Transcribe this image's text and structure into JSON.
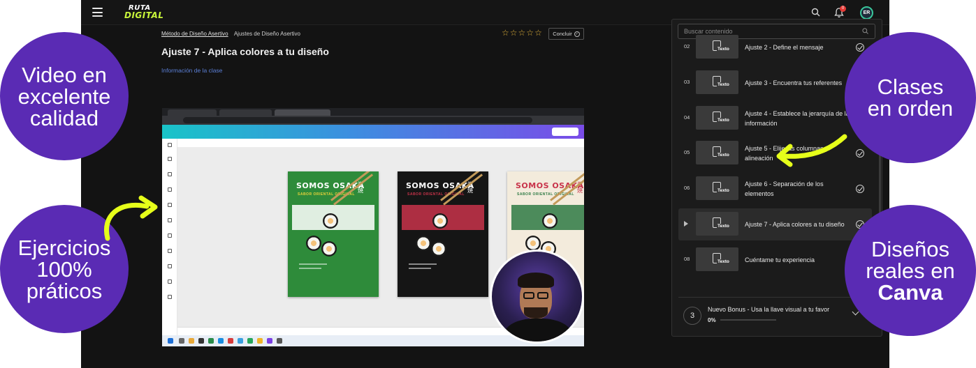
{
  "header": {
    "logo_line1": "RUTA",
    "logo_line2": "DIGITAL",
    "notification_count": "0",
    "avatar_initials": "ER"
  },
  "breadcrumb": {
    "course": "Método de Diseño Asertivo",
    "section": "Ajustes de Diseño Asertivo"
  },
  "rating": {
    "stars_filled": 0,
    "stars_total": 5
  },
  "concluir_label": "Concluir",
  "lesson_title": "Ajuste 7 - Aplica colores a tu diseño",
  "info_link": "Información de la clase",
  "sidebar": {
    "search_placeholder": "Buscar contenido",
    "thumb_label": "Texto",
    "lessons": [
      {
        "num": "02",
        "title": "Ajuste 2 - Define el mensaje",
        "completed": true,
        "active": false
      },
      {
        "num": "03",
        "title": "Ajuste 3 - Encuentra tus referentes",
        "completed": true,
        "active": false
      },
      {
        "num": "04",
        "title": "Ajuste 4 - Establece la jerarquía de la información",
        "completed": true,
        "active": false
      },
      {
        "num": "05",
        "title": "Ajuste 5 - Elije las columnas y alineación",
        "completed": true,
        "active": false
      },
      {
        "num": "06",
        "title": "Ajuste 6 - Separación de los elementos",
        "completed": true,
        "active": false
      },
      {
        "num": "",
        "title": "Ajuste 7 - Aplica colores a tu diseño",
        "completed": true,
        "active": true
      },
      {
        "num": "08",
        "title": "Cuéntame tu experiencia",
        "completed": true,
        "active": false
      }
    ],
    "bonus": {
      "num": "3",
      "title": "Nuevo Bonus - Usa la llave visual a tu favor",
      "progress": "0%",
      "progress_value": 0
    }
  },
  "promos": {
    "video": [
      "Video en",
      "excelente",
      "calidad"
    ],
    "clases": [
      "Clases",
      "en orden"
    ],
    "ejercicios": [
      "Ejercicios",
      "100%",
      "práticos"
    ],
    "disenos": [
      "Diseños",
      "reales en",
      "Canva"
    ]
  },
  "video_embed": {
    "posters": [
      {
        "title": "SOMOS OSAKA",
        "subtitle": "SABOR ORIENTAL ORIGINAL",
        "bg": "#2e8b3a",
        "band": "#ffffff",
        "text": "#ffffff",
        "accent": "#e8d23a"
      },
      {
        "title": "SOMOS OSAKA",
        "subtitle": "SABOR ORIENTAL ORIGINAL",
        "bg": "#151515",
        "band": "#c8334a",
        "text": "#ffffff",
        "accent": "#c8334a"
      },
      {
        "title": "SOMOS OSAKA",
        "subtitle": "SABOR ORIENTAL ORIGINAL",
        "bg": "#f3ebdc",
        "band": "#2e7a44",
        "text": "#c8334a",
        "accent": "#2e7a44"
      }
    ]
  },
  "colors": {
    "promo_purple": "#5a2bb4",
    "arrow_yellow": "#e6ff1a",
    "star": "#e3b43b",
    "link": "#5b7fd6",
    "app_bg": "#131313"
  }
}
